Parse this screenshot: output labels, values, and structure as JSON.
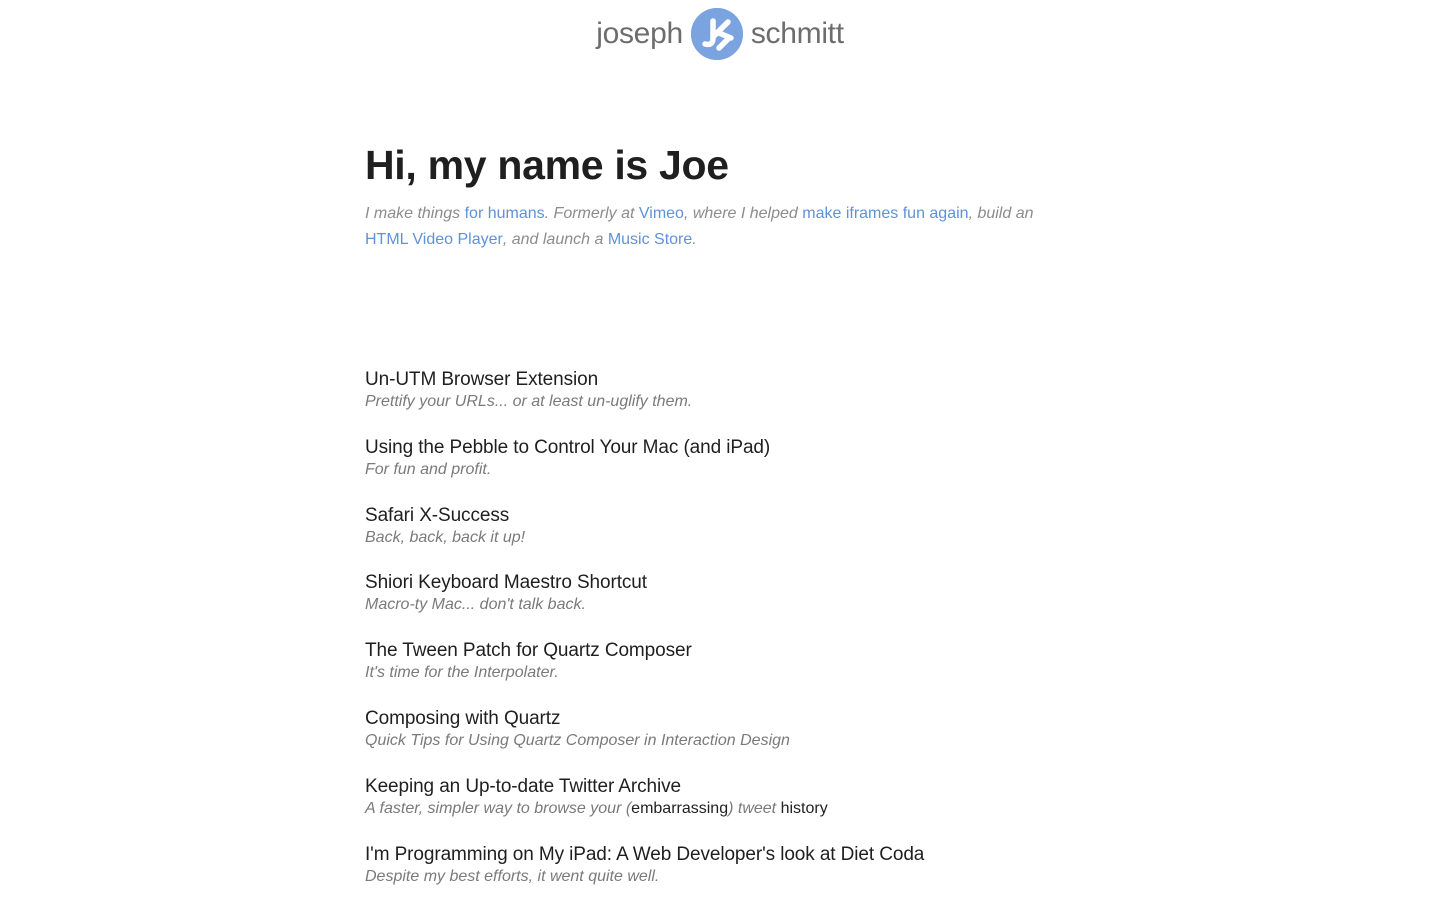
{
  "header": {
    "first_name": "joseph",
    "last_name": "schmitt"
  },
  "intro": {
    "heading": "Hi, my name is Joe",
    "tagline": {
      "t1": "I make things ",
      "link_humans": "for humans",
      "t2": ". Formerly at ",
      "link_vimeo": "Vimeo",
      "t3": ", where I helped ",
      "link_iframes": "make iframes fun again",
      "t4": ", build an",
      "link_player": "HTML Video Player",
      "t5": ", and launch a ",
      "link_store": "Music Store",
      "t6": "."
    }
  },
  "posts": [
    {
      "title": "Un-UTM Browser Extension",
      "desc": "Prettify your URLs... or at least un-uglify them."
    },
    {
      "title": "Using the Pebble to Control Your Mac (and iPad)",
      "desc": "For fun and profit."
    },
    {
      "title": "Safari X-Success",
      "desc": "Back, back, back it up!"
    },
    {
      "title": "Shiori Keyboard Maestro Shortcut",
      "desc": "Macro-ty Mac... don't talk back."
    },
    {
      "title": "The Tween Patch for Quartz Composer",
      "desc": "It's time for the Interpolater."
    },
    {
      "title": "Composing with Quartz",
      "desc": "Quick Tips for Using Quartz Composer in Interaction Design"
    },
    {
      "title": "Keeping an Up-to-date Twitter Archive",
      "desc_parts": {
        "a": "A faster, simpler way to browse your (",
        "b": "embarrassing",
        "c": ") tweet ",
        "d": "history"
      }
    },
    {
      "title": "I'm Programming on My iPad: A Web Developer's look at Diet Coda",
      "desc": "Despite my best efforts, it went quite well."
    }
  ],
  "colors": {
    "link": "#5f92d8",
    "logo": "#7ba3e0",
    "muted": "#8c8c8c",
    "text": "#1f1f1f"
  }
}
